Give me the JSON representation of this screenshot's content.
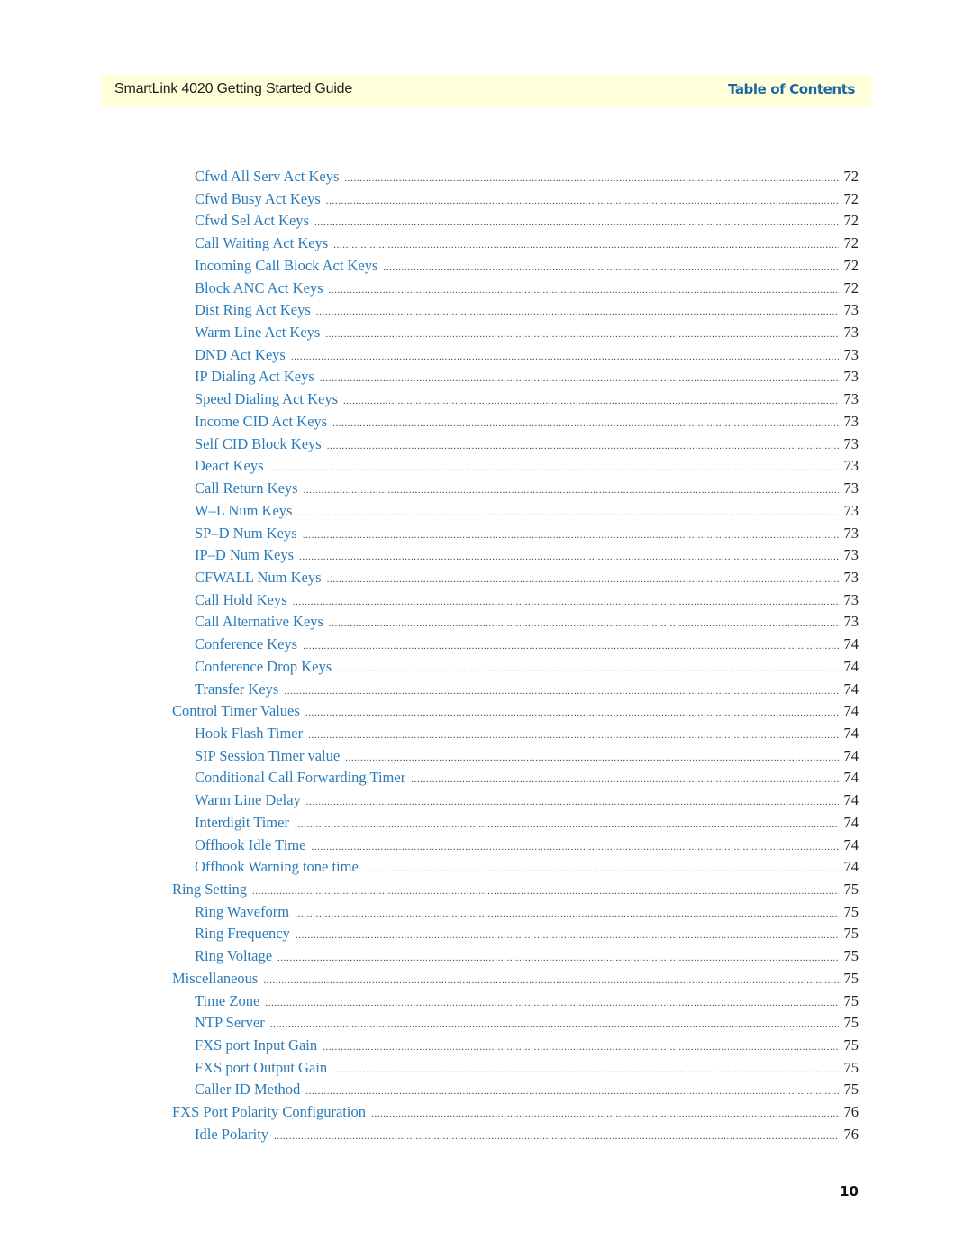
{
  "header": {
    "title": "SmartLink 4020 Getting Started Guide",
    "section": "Table of Contents"
  },
  "toc": [
    {
      "level": 2,
      "label": "Cfwd All Serv Act Keys",
      "page": "72"
    },
    {
      "level": 2,
      "label": "Cfwd Busy Act Keys",
      "page": "72"
    },
    {
      "level": 2,
      "label": "Cfwd Sel Act Keys",
      "page": "72"
    },
    {
      "level": 2,
      "label": "Call Waiting Act Keys",
      "page": "72"
    },
    {
      "level": 2,
      "label": "Incoming Call Block Act Keys",
      "page": "72"
    },
    {
      "level": 2,
      "label": "Block ANC Act Keys",
      "page": "72"
    },
    {
      "level": 2,
      "label": "Dist Ring Act Keys",
      "page": "73"
    },
    {
      "level": 2,
      "label": "Warm Line Act Keys",
      "page": "73"
    },
    {
      "level": 2,
      "label": "DND Act Keys",
      "page": "73"
    },
    {
      "level": 2,
      "label": "IP Dialing Act Keys",
      "page": "73"
    },
    {
      "level": 2,
      "label": "Speed Dialing Act Keys",
      "page": "73"
    },
    {
      "level": 2,
      "label": "Income CID Act Keys",
      "page": "73"
    },
    {
      "level": 2,
      "label": "Self CID Block Keys",
      "page": "73"
    },
    {
      "level": 2,
      "label": "Deact Keys",
      "page": "73"
    },
    {
      "level": 2,
      "label": "Call Return Keys",
      "page": "73"
    },
    {
      "level": 2,
      "label": "W–L Num Keys",
      "page": "73"
    },
    {
      "level": 2,
      "label": "SP–D Num Keys",
      "page": "73"
    },
    {
      "level": 2,
      "label": "IP–D Num Keys",
      "page": "73"
    },
    {
      "level": 2,
      "label": "CFWALL Num Keys",
      "page": "73"
    },
    {
      "level": 2,
      "label": "Call Hold Keys",
      "page": "73"
    },
    {
      "level": 2,
      "label": "Call Alternative Keys",
      "page": "73"
    },
    {
      "level": 2,
      "label": "Conference Keys",
      "page": "74"
    },
    {
      "level": 2,
      "label": "Conference Drop Keys",
      "page": "74"
    },
    {
      "level": 2,
      "label": "Transfer Keys",
      "page": "74"
    },
    {
      "level": 1,
      "label": "Control Timer Values",
      "page": "74"
    },
    {
      "level": 2,
      "label": "Hook Flash Timer",
      "page": "74"
    },
    {
      "level": 2,
      "label": "SIP Session Timer value",
      "page": "74"
    },
    {
      "level": 2,
      "label": "Conditional Call Forwarding Timer",
      "page": "74"
    },
    {
      "level": 2,
      "label": "Warm Line Delay",
      "page": "74"
    },
    {
      "level": 2,
      "label": "Interdigit Timer",
      "page": "74"
    },
    {
      "level": 2,
      "label": "Offhook Idle Time",
      "page": "74"
    },
    {
      "level": 2,
      "label": "Offhook Warning tone time",
      "page": "74"
    },
    {
      "level": 1,
      "label": "Ring Setting",
      "page": "75"
    },
    {
      "level": 2,
      "label": "Ring Waveform",
      "page": "75"
    },
    {
      "level": 2,
      "label": "Ring Frequency",
      "page": "75"
    },
    {
      "level": 2,
      "label": "Ring Voltage",
      "page": "75"
    },
    {
      "level": 1,
      "label": "Miscellaneous",
      "page": "75"
    },
    {
      "level": 2,
      "label": "Time Zone",
      "page": "75"
    },
    {
      "level": 2,
      "label": "NTP Server",
      "page": "75"
    },
    {
      "level": 2,
      "label": "FXS port Input Gain",
      "page": "75"
    },
    {
      "level": 2,
      "label": "FXS port Output Gain",
      "page": "75"
    },
    {
      "level": 2,
      "label": "Caller ID Method",
      "page": "75"
    },
    {
      "level": 1,
      "label": "FXS Port Polarity Configuration",
      "page": "76"
    },
    {
      "level": 2,
      "label": "Idle Polarity",
      "page": "76"
    }
  ],
  "footer": {
    "page_number": "10"
  },
  "colors": {
    "header_bg": "#ffffd9",
    "link": "#2b7bb9",
    "section_title": "#1a66a8"
  }
}
